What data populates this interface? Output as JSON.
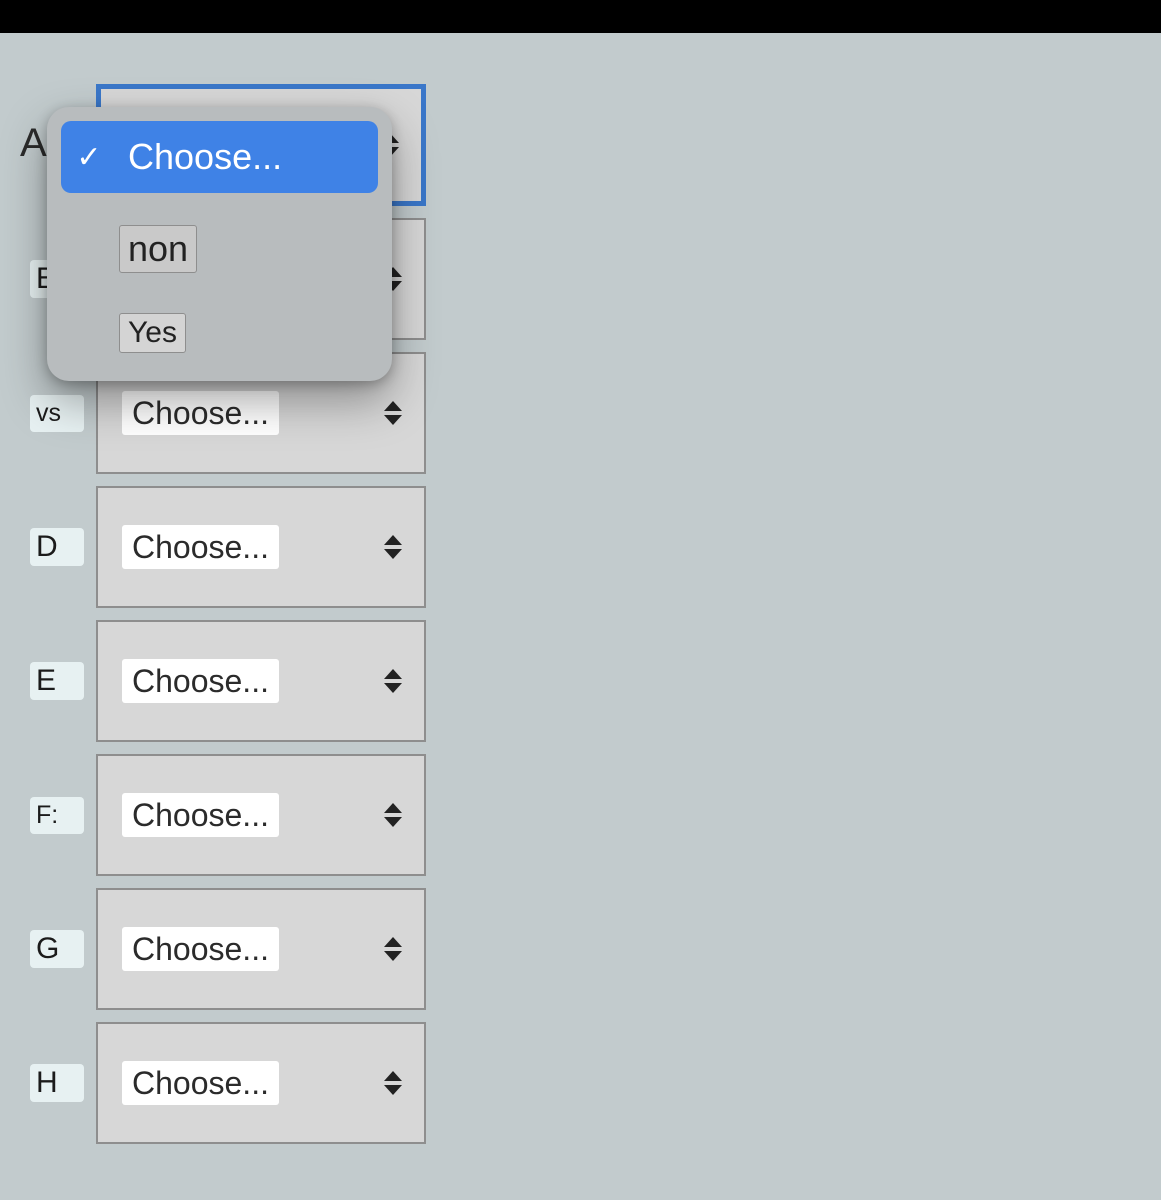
{
  "rows": [
    {
      "label": "A",
      "value": "Choose...",
      "active": true
    },
    {
      "label": "E",
      "value": "Choose..."
    },
    {
      "label": "vs",
      "value": "Choose..."
    },
    {
      "label": "D",
      "value": "Choose..."
    },
    {
      "label": "E",
      "value": "Choose..."
    },
    {
      "label": "F:",
      "value": "Choose..."
    },
    {
      "label": "G",
      "value": "Choose..."
    },
    {
      "label": "H",
      "value": "Choose..."
    }
  ],
  "dropdown": {
    "options": [
      {
        "label": "Choose...",
        "selected": true
      },
      {
        "label": "non"
      },
      {
        "label": "Yes"
      }
    ]
  }
}
